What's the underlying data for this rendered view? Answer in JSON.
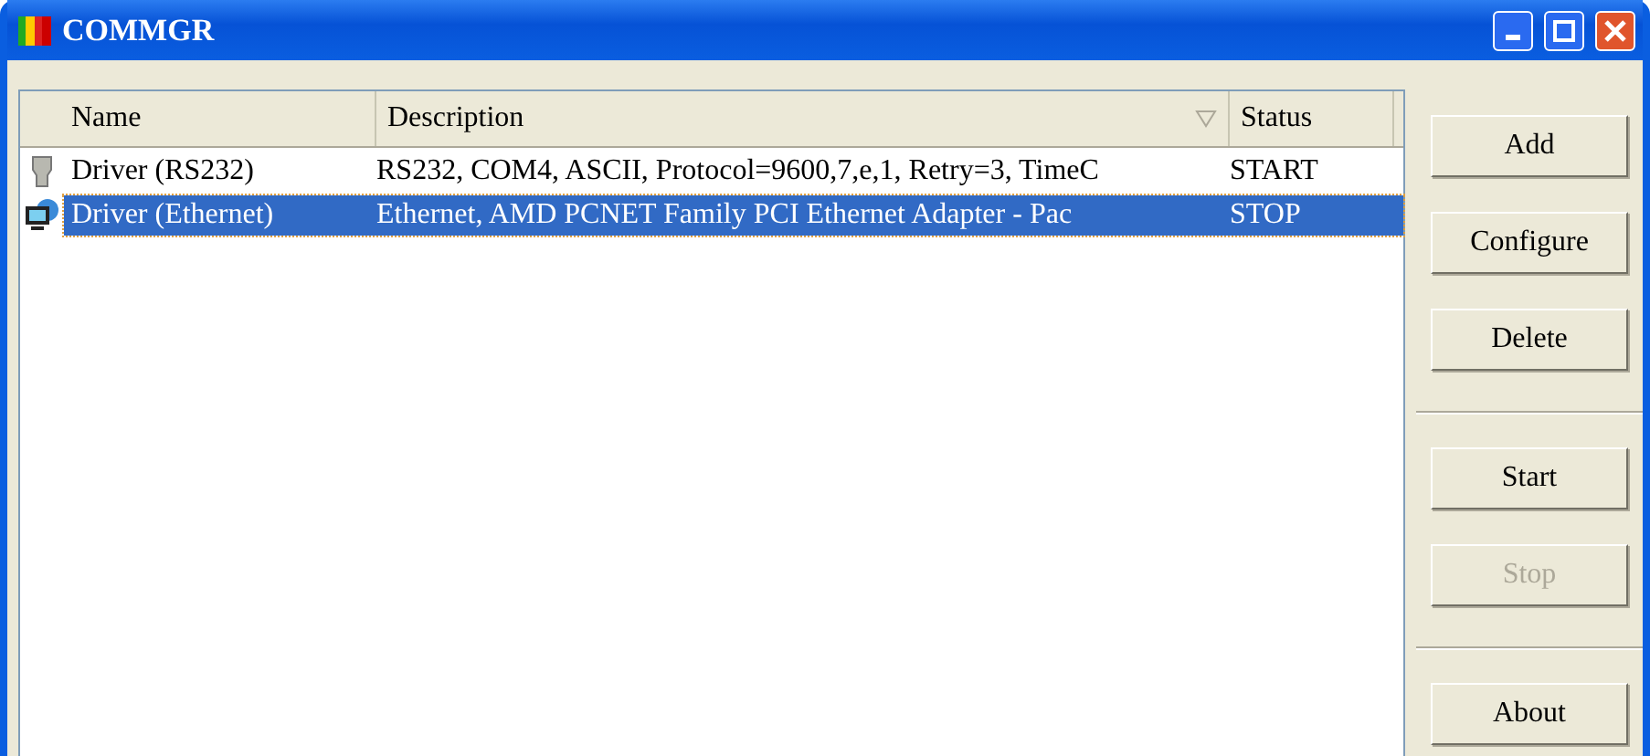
{
  "window": {
    "title": "COMMGR"
  },
  "table": {
    "columns": [
      {
        "label": "Name"
      },
      {
        "label": "Description",
        "sorted": true
      },
      {
        "label": "Status"
      }
    ],
    "rows": [
      {
        "kind": "serial",
        "selected": false,
        "cells": [
          "Driver (RS232)",
          "RS232, COM4, ASCII, Protocol=9600,7,e,1, Retry=3, TimeC",
          "START"
        ]
      },
      {
        "kind": "network",
        "selected": true,
        "cells": [
          "Driver (Ethernet)",
          "Ethernet, AMD PCNET Family PCI Ethernet Adapter - Pac",
          "STOP"
        ]
      }
    ]
  },
  "button_groups": [
    [
      {
        "label": "Add",
        "disabled": false
      },
      {
        "label": "Configure",
        "disabled": false
      },
      {
        "label": "Delete",
        "disabled": false
      }
    ],
    [
      {
        "label": "Start",
        "disabled": false
      },
      {
        "label": "Stop",
        "disabled": true
      }
    ],
    [
      {
        "label": "About",
        "disabled": false
      }
    ]
  ]
}
